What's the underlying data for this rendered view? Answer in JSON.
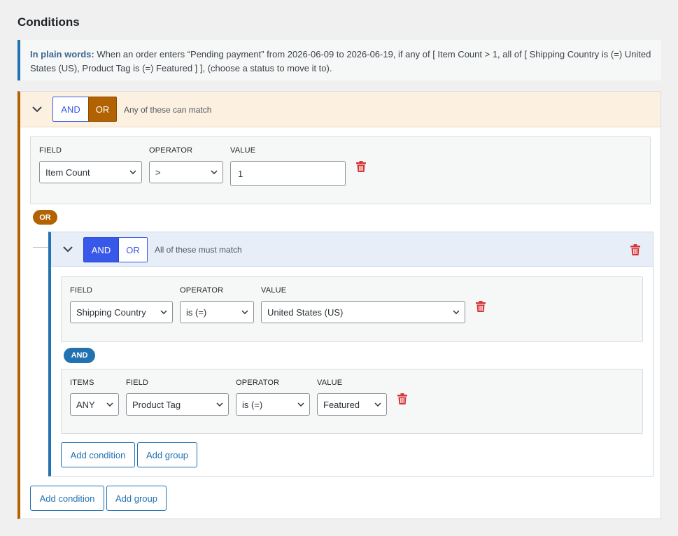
{
  "page": {
    "title": "Conditions"
  },
  "plain_words": {
    "label": "In plain words:",
    "text_line1": "When an order enters “Pending payment” from 2026-06-09 to 2026-06-19, if any of [ Item Count > 1, all of [ Shipping Country is (=) United",
    "text_line2": "States (US), Product Tag is (=) Featured ] ], (choose a status to move it to)."
  },
  "outer_group": {
    "and_label": "AND",
    "or_label": "OR",
    "active": "OR",
    "hint": "Any of these can match",
    "condition1": {
      "field_label": "FIELD",
      "operator_label": "OPERATOR",
      "value_label": "VALUE",
      "field_value": "Item Count",
      "operator_value": ">",
      "value": "1"
    },
    "connector": "OR",
    "add_condition": "Add condition",
    "add_group": "Add group"
  },
  "inner_group": {
    "and_label": "AND",
    "or_label": "OR",
    "active": "AND",
    "hint": "All of these must match",
    "condition1": {
      "field_label": "FIELD",
      "operator_label": "OPERATOR",
      "value_label": "VALUE",
      "field_value": "Shipping Country",
      "operator_value": "is (=)",
      "value": "United States (US)"
    },
    "connector": "AND",
    "condition2": {
      "items_label": "ITEMS",
      "field_label": "FIELD",
      "operator_label": "OPERATOR",
      "value_label": "VALUE",
      "items_value": "ANY",
      "field_value": "Product Tag",
      "operator_value": "is (=)",
      "value": "Featured"
    },
    "add_condition": "Add condition",
    "add_group": "Add group"
  },
  "colors": {
    "or_accent": "#b26200",
    "and_accent": "#2271b1",
    "and_active": "#3858e9",
    "delete_red": "#d63638"
  },
  "icons": {
    "collapse": "chevron-down-icon",
    "select_caret": "chevron-down-icon",
    "delete": "trash-icon"
  }
}
